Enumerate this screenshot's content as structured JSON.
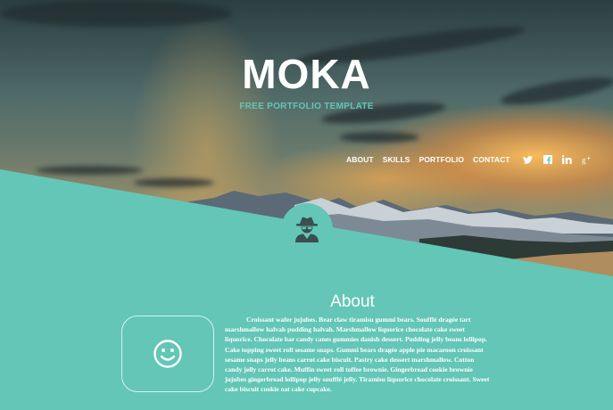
{
  "brand": {
    "title": "MOKA",
    "subtitle": "FREE PORTFOLIO TEMPLATE"
  },
  "nav": {
    "items": [
      {
        "label": "ABOUT"
      },
      {
        "label": "SKILLS"
      },
      {
        "label": "PORTFOLIO"
      },
      {
        "label": "CONTACT"
      }
    ],
    "social": [
      "twitter-icon",
      "facebook-icon",
      "linkedin-icon",
      "google-plus-icon"
    ]
  },
  "hero": {
    "badge_icon": "spy-icon"
  },
  "about": {
    "heading": "About",
    "icon": "smiley-icon",
    "text": "Croissant wafer jujubes. Bear claw tiramisu gummi bears. Soufflé dragée tart marshmallow halvah pudding halvah. Marshmallow liquorice chocolate cake sweet liquorice. Chocolate bar candy canes gummies danish dessert. Pudding jelly beans lollipop. Cake topping sweet roll sesame snaps. Gummi bears dragée apple pie macaroon croissant sesame snaps jelly beans carrot cake biscuit. Pastry cake dessert marshmallow. Cotton candy jelly carrot cake. Muffin sweet roll toffee brownie. Gingerbread cookie brownie jujubes gingerbread lollipop jelly soufflé jelly. Tiramisu liquorice chocolate croissant. Sweet cake biscuit cookie oat cake cupcake."
  },
  "colors": {
    "accent": "#63c6b7",
    "text_light": "#ffffff",
    "icon_dark": "#3a4f52"
  }
}
